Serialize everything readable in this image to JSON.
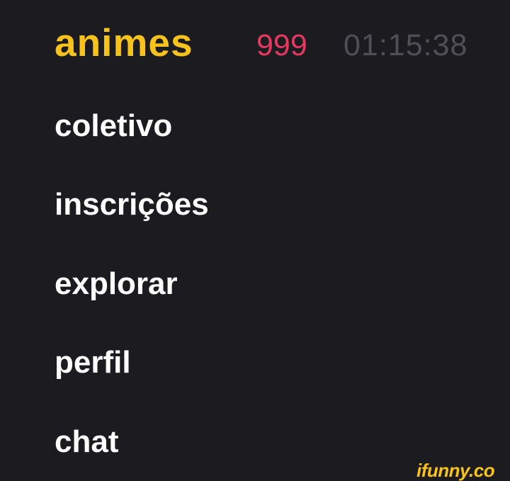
{
  "header": {
    "community_name": "animes",
    "notification_count": "999",
    "clock": "01:15:38"
  },
  "menu": {
    "items": [
      {
        "label": "coletivo"
      },
      {
        "label": "inscrições"
      },
      {
        "label": "explorar"
      },
      {
        "label": "perfil"
      },
      {
        "label": "chat"
      }
    ]
  },
  "watermark": "ifunny.co",
  "colors": {
    "background": "#1b1b20",
    "accent": "#f7c31a",
    "badge": "#e6395f",
    "clock": "#4f4f56",
    "menu_text": "#ffffff"
  }
}
